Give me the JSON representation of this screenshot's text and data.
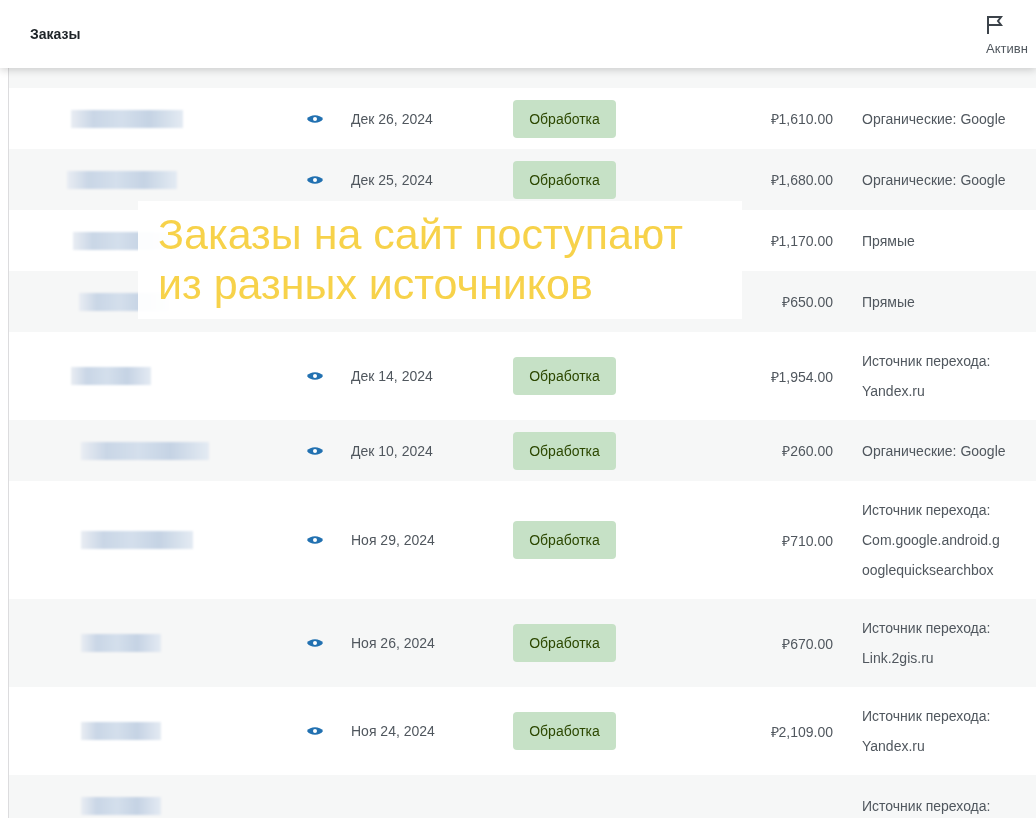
{
  "header": {
    "title": "Заказы",
    "status_label": "Активн"
  },
  "caption": {
    "lines": [
      "Заказы на сайт поступают",
      "из разных источников"
    ]
  },
  "rows": [
    {
      "date": "Дек 26, 2024",
      "status": "Обработка",
      "total": "₽1,610.00",
      "source": "Органические: Google"
    },
    {
      "date": "Дек 25, 2024",
      "status": "Обработка",
      "total": "₽1,680.00",
      "source": "Органические: Google"
    },
    {
      "total": "₽1,170.00",
      "source": "Прямые"
    },
    {
      "total": "₽650.00",
      "source": "Прямые"
    },
    {
      "date": "Дек 14, 2024",
      "status": "Обработка",
      "total": "₽1,954.00",
      "source": "Источник перехода: Yandex.ru"
    },
    {
      "date": "Дек 10, 2024",
      "status": "Обработка",
      "total": "₽260.00",
      "source": "Органические: Google"
    },
    {
      "date": "Ноя 29, 2024",
      "status": "Обработка",
      "total": "₽710.00",
      "source": "Источник перехода: Com.google.android.googlequicksearchbox"
    },
    {
      "date": "Ноя 26, 2024",
      "status": "Обработка",
      "total": "₽670.00",
      "source": "Источник перехода: Link.2gis.ru"
    },
    {
      "date": "Ноя 24, 2024",
      "status": "Обработка",
      "total": "₽2,109.00",
      "source": "Источник перехода: Yandex.ru"
    },
    {
      "source": "Источник перехода:"
    }
  ]
}
